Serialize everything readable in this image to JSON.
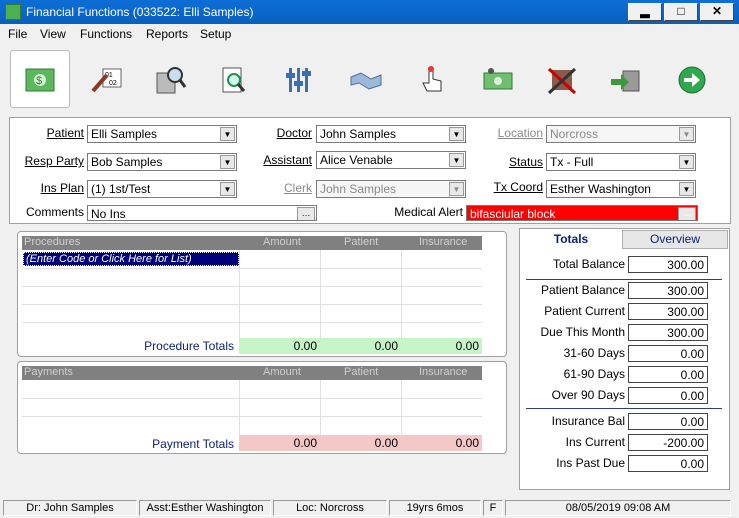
{
  "window": {
    "title": "Financial Functions (033522: Elli Samples)",
    "minimize": "▂",
    "maximize": "□",
    "close": "✕"
  },
  "menu": [
    "File",
    "View",
    "Functions",
    "Reports",
    "Setup"
  ],
  "toolbar_icons": [
    "ledger-money-icon",
    "calendar-pen-icon",
    "calculator-search-icon",
    "document-search-icon",
    "sliders-icon",
    "handshake-icon",
    "hand-pointer-icon",
    "money-bill-icon",
    "crossed-swords-icon",
    "transfer-icon",
    "next-arrow-icon"
  ],
  "form": {
    "patient": {
      "label": "Patient",
      "value": "Elli Samples"
    },
    "resp_party": {
      "label": "Resp Party",
      "value": "Bob Samples"
    },
    "ins_plan": {
      "label": "Ins Plan",
      "value": "(1) 1st/Test"
    },
    "comments": {
      "label": "Comments",
      "value": "No Ins"
    },
    "doctor": {
      "label": "Doctor",
      "value": "John Samples"
    },
    "assistant": {
      "label": "Assistant",
      "value": "Alice Venable"
    },
    "clerk": {
      "label": "Clerk",
      "value": "John Samples"
    },
    "location": {
      "label": "Location",
      "value": "Norcross"
    },
    "status": {
      "label": "Status",
      "value": "Tx - Full"
    },
    "tx_coord": {
      "label": "Tx Coord",
      "value": "Esther Washington"
    },
    "medical_alert": {
      "label": "Medical Alert",
      "value": "bifasciular block"
    }
  },
  "procedures": {
    "headers": [
      "Procedures",
      "Amount",
      "Patient",
      "Insurance"
    ],
    "entry_prompt": "(Enter Code or Click Here for List)",
    "totals_label": "Procedure Totals",
    "totals": [
      "0.00",
      "0.00",
      "0.00"
    ]
  },
  "payments": {
    "headers": [
      "Payments",
      "Amount",
      "Patient",
      "Insurance"
    ],
    "totals_label": "Payment Totals",
    "totals": [
      "0.00",
      "0.00",
      "0.00"
    ]
  },
  "tabs": [
    "Totals",
    "Overview"
  ],
  "balances": {
    "total_balance": {
      "label": "Total Balance",
      "value": "300.00"
    },
    "patient_balance": {
      "label": "Patient Balance",
      "value": "300.00"
    },
    "patient_current": {
      "label": "Patient Current",
      "value": "300.00"
    },
    "due_this_month": {
      "label": "Due This Month",
      "value": "300.00"
    },
    "d31_60": {
      "label": "31-60 Days",
      "value": "0.00"
    },
    "d61_90": {
      "label": "61-90 Days",
      "value": "0.00"
    },
    "over_90": {
      "label": "Over 90 Days",
      "value": "0.00"
    },
    "insurance_bal": {
      "label": "Insurance Bal",
      "value": "0.00"
    },
    "ins_current": {
      "label": "Ins Current",
      "value": "-200.00"
    },
    "ins_past_due": {
      "label": "Ins Past Due",
      "value": "0.00"
    }
  },
  "status_bar": {
    "doctor": "Dr: John Samples",
    "assistant": "Asst:Esther Washington",
    "location": "Loc: Norcross",
    "age": "19yrs 6mos",
    "gender": "F",
    "datetime": "08/05/2019 09:08 AM"
  },
  "colors": {
    "titlebar": "#0a64c8",
    "alert": "#ff0000",
    "procedure_totals": "#c8f5c8",
    "payment_totals": "#f5c8c8",
    "grid_header": "#808080"
  }
}
